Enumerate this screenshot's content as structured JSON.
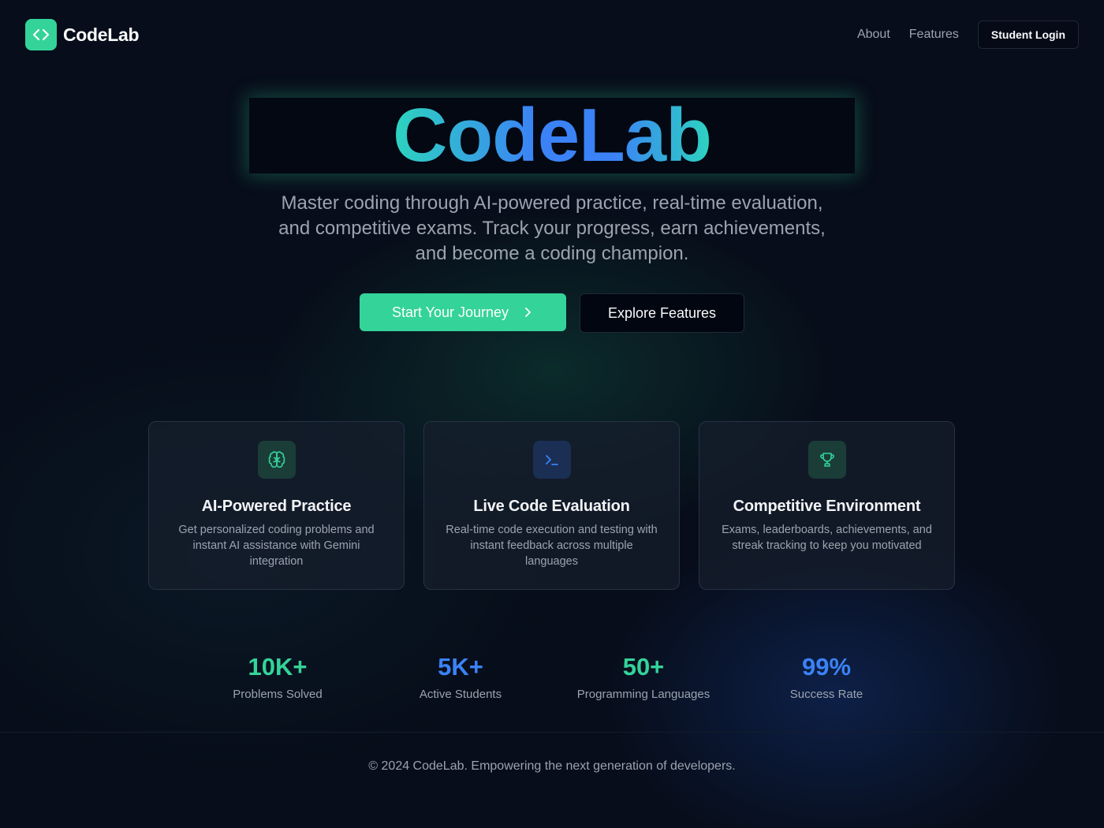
{
  "brand": {
    "name": "CodeLab",
    "logo_icon": "code-brackets-icon",
    "accent": "#34d399"
  },
  "nav": {
    "links": [
      "About",
      "Features"
    ],
    "login_label": "Student Login"
  },
  "hero": {
    "title": "CodeLab",
    "subtitle_lines": [
      "Master coding through AI-powered practice, real-time evaluation,",
      "and competitive exams. Track your progress, earn achievements,",
      "and become a coding champion."
    ],
    "primary_cta": "Start Your Journey",
    "secondary_cta": "Explore Features"
  },
  "features": [
    {
      "icon": "brain-icon",
      "title": "AI-Powered Practice",
      "description": "Get personalized coding problems and instant AI assistance with Gemini integration",
      "icon_bg": "#1a3d38",
      "icon_color": "#34d399"
    },
    {
      "icon": "terminal-icon",
      "title": "Live Code Evaluation",
      "description": "Real-time code execution and testing with instant feedback across multiple languages",
      "icon_bg": "#1b2f55",
      "icon_color": "#3b82f6"
    },
    {
      "icon": "trophy-icon",
      "title": "Competitive Environment",
      "description": "Exams, leaderboards, achievements, and streak tracking to keep you motivated",
      "icon_bg": "#1a3d38",
      "icon_color": "#34d399"
    }
  ],
  "stats": [
    {
      "value": "10K+",
      "label": "Problems Solved",
      "color": "#34d399"
    },
    {
      "value": "5K+",
      "label": "Active Students",
      "color": "#3b82f6"
    },
    {
      "value": "50+",
      "label": "Programming Languages",
      "color": "#34d399"
    },
    {
      "value": "99%",
      "label": "Success Rate",
      "color": "#3b82f6"
    }
  ],
  "footer": {
    "text": "© 2024 CodeLab. Empowering the next generation of developers."
  }
}
